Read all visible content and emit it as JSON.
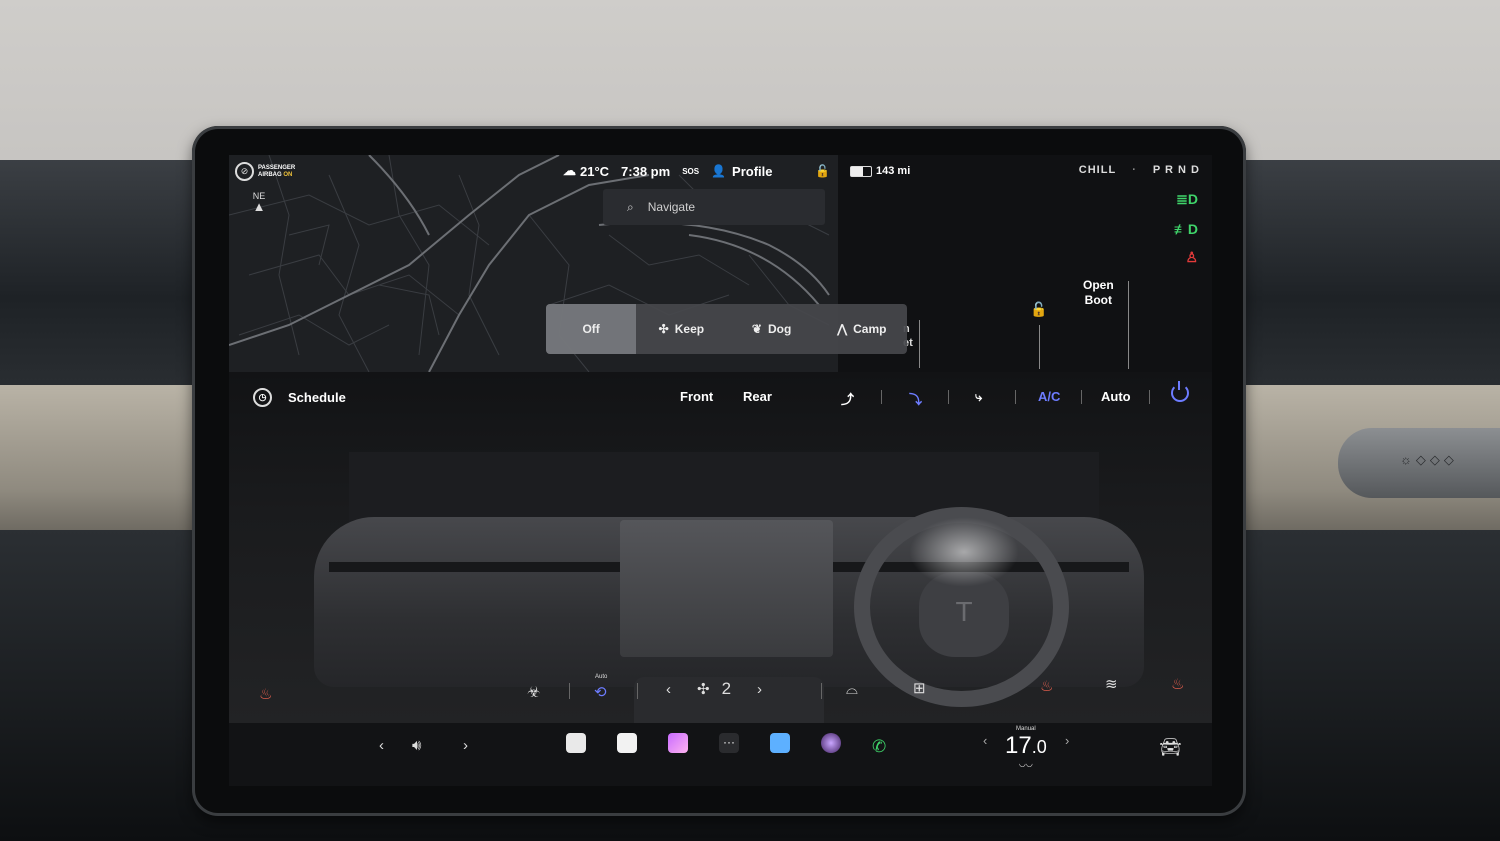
{
  "status": {
    "airbag_line1": "PASSENGER",
    "airbag_line2": "AIRBAG",
    "airbag_state": "ON",
    "compass": "NE",
    "weather_temp": "21°C",
    "time": "7:38 pm",
    "sos": "SOS",
    "profile": "Profile",
    "range": "143 mi",
    "battery_level": 0.6,
    "drive_mode": "CHILL",
    "gears": "P R N D"
  },
  "map": {
    "search_placeholder": "Navigate"
  },
  "vehicle": {
    "open_boot_line1": "Open",
    "open_boot_line2": "Boot",
    "frunk_partial_1": "n",
    "frunk_partial_2": "et"
  },
  "keep_modes": {
    "items": [
      "Off",
      "Keep",
      "Dog",
      "Camp"
    ],
    "selected": "Off"
  },
  "climate": {
    "schedule": "Schedule",
    "front": "Front",
    "rear": "Rear",
    "ac": "A/C",
    "auto": "Auto",
    "recirc_mode": "Auto",
    "fan_level": "2"
  },
  "taskbar": {
    "temp_mode": "Manual",
    "temp_int": "17",
    "temp_dec": ".0"
  },
  "colors": {
    "accent_blue": "#6d7cff",
    "light_green": "#3fd46a",
    "alert_red": "#e33a3a",
    "heat_red": "#e8604f"
  }
}
